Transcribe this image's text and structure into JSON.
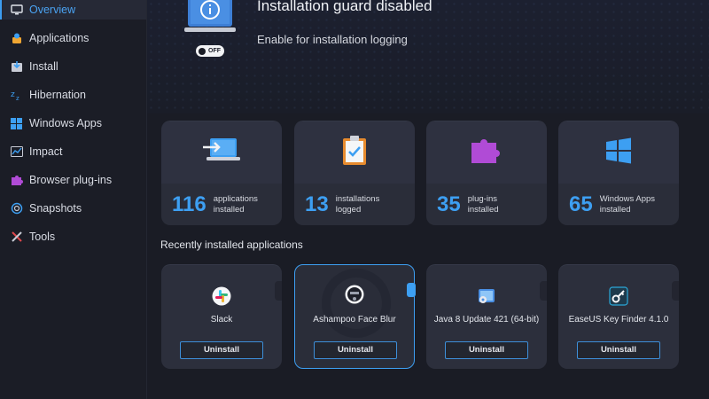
{
  "sidebar": {
    "items": [
      {
        "label": "Overview",
        "icon": "monitor-icon",
        "active": true
      },
      {
        "label": "Applications",
        "icon": "applications-icon"
      },
      {
        "label": "Install",
        "icon": "install-icon"
      },
      {
        "label": "Hibernation",
        "icon": "sleep-icon"
      },
      {
        "label": "Windows Apps",
        "icon": "windows-icon"
      },
      {
        "label": "Impact",
        "icon": "impact-icon"
      },
      {
        "label": "Browser plug-ins",
        "icon": "puzzle-icon"
      },
      {
        "label": "Snapshots",
        "icon": "snapshots-icon"
      },
      {
        "label": "Tools",
        "icon": "tools-icon"
      }
    ]
  },
  "header": {
    "title": "Installation guard disabled",
    "subtitle": "Enable for installation logging",
    "toggle_label": "OFF"
  },
  "stats": [
    {
      "value": "116",
      "label": "applications installed",
      "icon": "laptop-import-icon"
    },
    {
      "value": "13",
      "label": "installations logged",
      "icon": "clipboard-check-icon"
    },
    {
      "value": "35",
      "label": "plug-ins installed",
      "icon": "puzzle-icon"
    },
    {
      "value": "65",
      "label": "Windows Apps installed",
      "icon": "windows-icon"
    }
  ],
  "recent": {
    "title": "Recently installed applications",
    "apps": [
      {
        "name": "Slack",
        "button": "Uninstall",
        "icon": "slack-icon"
      },
      {
        "name": "Ashampoo Face Blur",
        "button": "Uninstall",
        "icon": "face-blur-icon"
      },
      {
        "name": "Java 8 Update 421 (64-bit)",
        "button": "Uninstall",
        "icon": "java-icon"
      },
      {
        "name": "EaseUS Key Finder 4.1.0",
        "button": "Uninstall",
        "icon": "key-icon"
      }
    ]
  },
  "colors": {
    "accent": "#3d9ff2",
    "background": "#1a1c25",
    "card": "#2a2d39"
  }
}
